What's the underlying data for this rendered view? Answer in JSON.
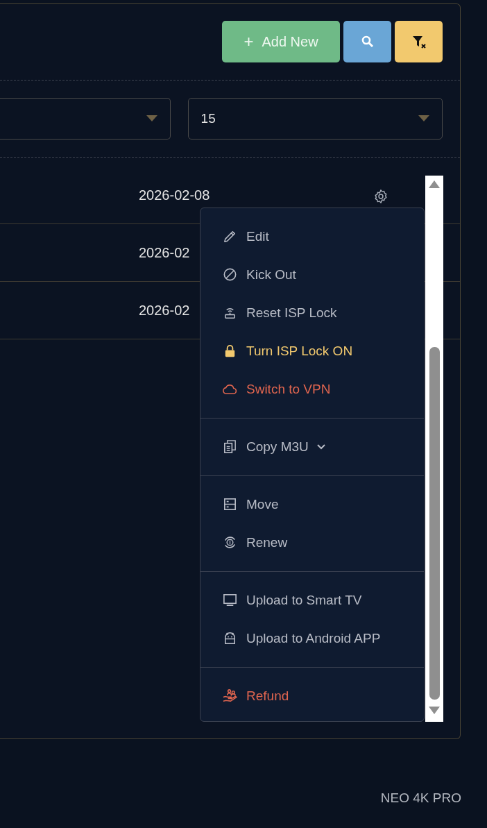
{
  "toolbar": {
    "add_button": {
      "icon": "+",
      "label": "Add New"
    }
  },
  "filters": {
    "page_size": "15"
  },
  "rows": [
    {
      "date": "2026-02-08"
    },
    {
      "date": "2026-02"
    },
    {
      "date": "2026-02"
    }
  ],
  "action_menu": {
    "groups": [
      [
        {
          "label": "Edit",
          "kind": "pencil",
          "color": "#b9bdc7"
        },
        {
          "label": "Kick Out",
          "kind": "ban",
          "color": "#b9bdc7"
        },
        {
          "label": "Reset ISP Lock",
          "kind": "router",
          "color": "#b9bdc7"
        },
        {
          "label": "Turn ISP Lock ON",
          "kind": "lock",
          "color": "#f2c96e"
        },
        {
          "label": "Switch to VPN",
          "kind": "cloud",
          "color": "#e0654f"
        }
      ],
      [
        {
          "label": "Copy M3U",
          "kind": "copy",
          "color": "#b9bdc7"
        }
      ],
      [
        {
          "label": "Move",
          "kind": "server",
          "color": "#b9bdc7"
        },
        {
          "label": "Renew",
          "kind": "dollar",
          "color": "#b9bdc7"
        }
      ],
      [
        {
          "label": "Upload to Smart TV",
          "kind": "monitor",
          "color": "#b9bdc7"
        },
        {
          "label": "Upload to Android APP",
          "kind": "android",
          "color": "#b9bdc7"
        }
      ],
      [
        {
          "label": "Refund",
          "kind": "refund",
          "color": "#e0654f"
        }
      ]
    ]
  },
  "footer": {
    "brand": "NEO 4K PRO"
  }
}
